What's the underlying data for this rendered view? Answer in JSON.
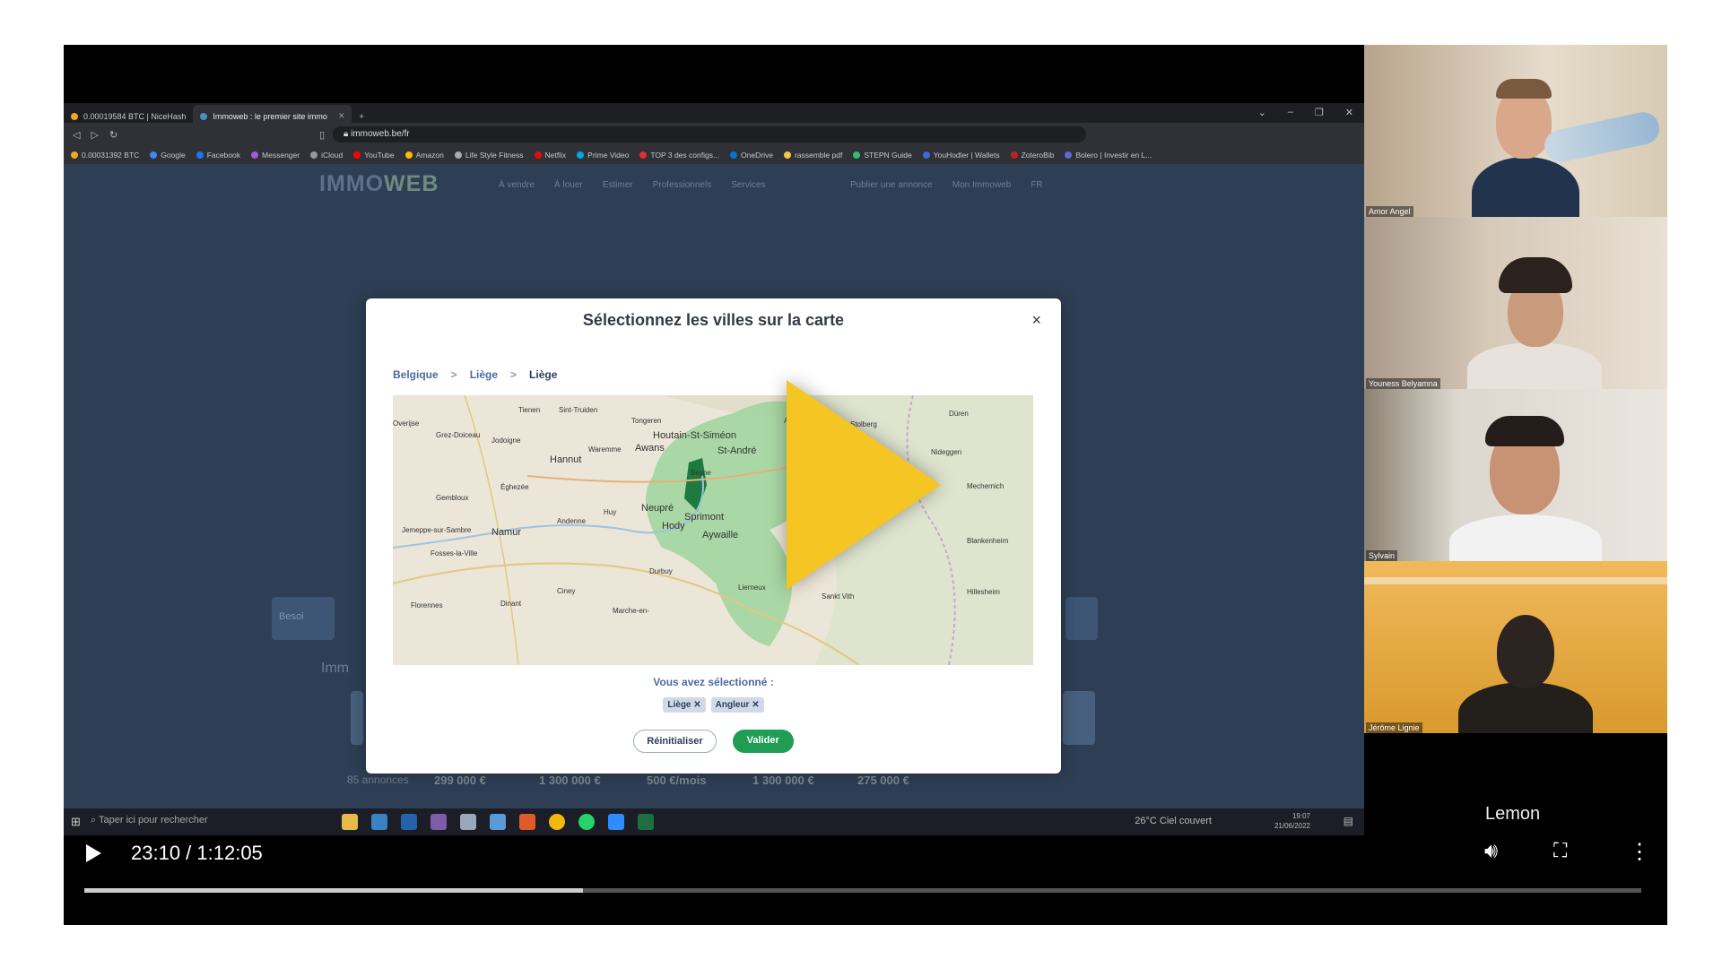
{
  "browser": {
    "tabs": [
      {
        "label": "0.00019584 BTC | NiceHash"
      },
      {
        "label": "Immoweb : le premier site immo"
      }
    ],
    "url": "immoweb.be/fr",
    "bookmarks": [
      "0.00031392 BTC",
      "Google",
      "Facebook",
      "Messenger",
      "iCloud",
      "YouTube",
      "Amazon",
      "Life Style Fitness",
      "Netflix",
      "Prime Video",
      "TOP 3 des configs...",
      "OneDrive",
      "rassemble pdf",
      "STEPN Guide",
      "YouHodler | Wallets",
      "ZoteroBib",
      "Bolero | Investir en L..."
    ]
  },
  "site": {
    "logo_a": "IMMO",
    "logo_b": "WEB",
    "nav": [
      "À vendre",
      "À louer",
      "Estimer",
      "Professionnels",
      "Services"
    ],
    "nav_right": [
      "Publier une annonce",
      "Mon Immoweb",
      "FR"
    ],
    "listings": [
      "299 000 €",
      "1 300 000 €",
      "500 €/mois",
      "1 300 000 €",
      "275 000 €"
    ],
    "count_text": "85 annonces",
    "side_text": "Besoi",
    "section_text": "Imm"
  },
  "modal": {
    "title": "Sélectionnez les villes sur la carte",
    "close": "×",
    "breadcrumb": [
      "Belgique",
      "Liège",
      "Liège"
    ],
    "breadcrumb_sep": ">",
    "selected_label": "Vous avez sélectionné :",
    "chips": [
      "Liège",
      "Angleur"
    ],
    "reset_label": "Réinitialiser",
    "ok_label": "Valider",
    "map_labels": [
      {
        "text": "Sint-Truiden"
      },
      {
        "text": "Tongeren"
      },
      {
        "text": "Aachen"
      },
      {
        "text": "Düren"
      },
      {
        "text": "Houtain-St-Siméon"
      },
      {
        "text": "Awans"
      },
      {
        "text": "St-André"
      },
      {
        "text": "Hannut"
      },
      {
        "text": "Waremme"
      },
      {
        "text": "Beyne"
      },
      {
        "text": "Jodoigne"
      },
      {
        "text": "Éghezée"
      },
      {
        "text": "Gembloux"
      },
      {
        "text": "Neupré"
      },
      {
        "text": "Sprimont"
      },
      {
        "text": "Hody"
      },
      {
        "text": "Aywaille"
      },
      {
        "text": "Namur"
      },
      {
        "text": "Andenne"
      },
      {
        "text": "Huy"
      },
      {
        "text": "Durbuy"
      },
      {
        "text": "Ciney"
      },
      {
        "text": "Dinant"
      },
      {
        "text": "Florennes"
      },
      {
        "text": "Marche-en-"
      },
      {
        "text": "Lierneux"
      },
      {
        "text": "Sankt Vith"
      },
      {
        "text": "Mechernich"
      },
      {
        "text": "Blankenheim"
      },
      {
        "text": "Hillesheim"
      },
      {
        "text": "Fosses-la-Ville"
      },
      {
        "text": "Jemeppe-sur-Sambre"
      },
      {
        "text": "Overijse"
      },
      {
        "text": "Grez-Doiceau"
      },
      {
        "text": "Tienen"
      },
      {
        "text": "Stolberg"
      },
      {
        "text": "Nideggen"
      }
    ]
  },
  "taskbar": {
    "search_placeholder": "Taper ici pour rechercher",
    "weather": "26°C  Ciel couvert",
    "time": "19:07",
    "date": "21/06/2022"
  },
  "video": {
    "current_time": "23:10 / 1:12:05",
    "progress": 0.32,
    "channel_label": "Lemon"
  },
  "participants": [
    {
      "name": "Amor Angel"
    },
    {
      "name": "Youness Belyamna"
    },
    {
      "name": "Sylvain"
    },
    {
      "name": "Jérôme Lignie"
    }
  ],
  "colors": {
    "accent_play": "#f5c524",
    "valider": "#1f9d55",
    "map_region": "#8fcf8f"
  }
}
